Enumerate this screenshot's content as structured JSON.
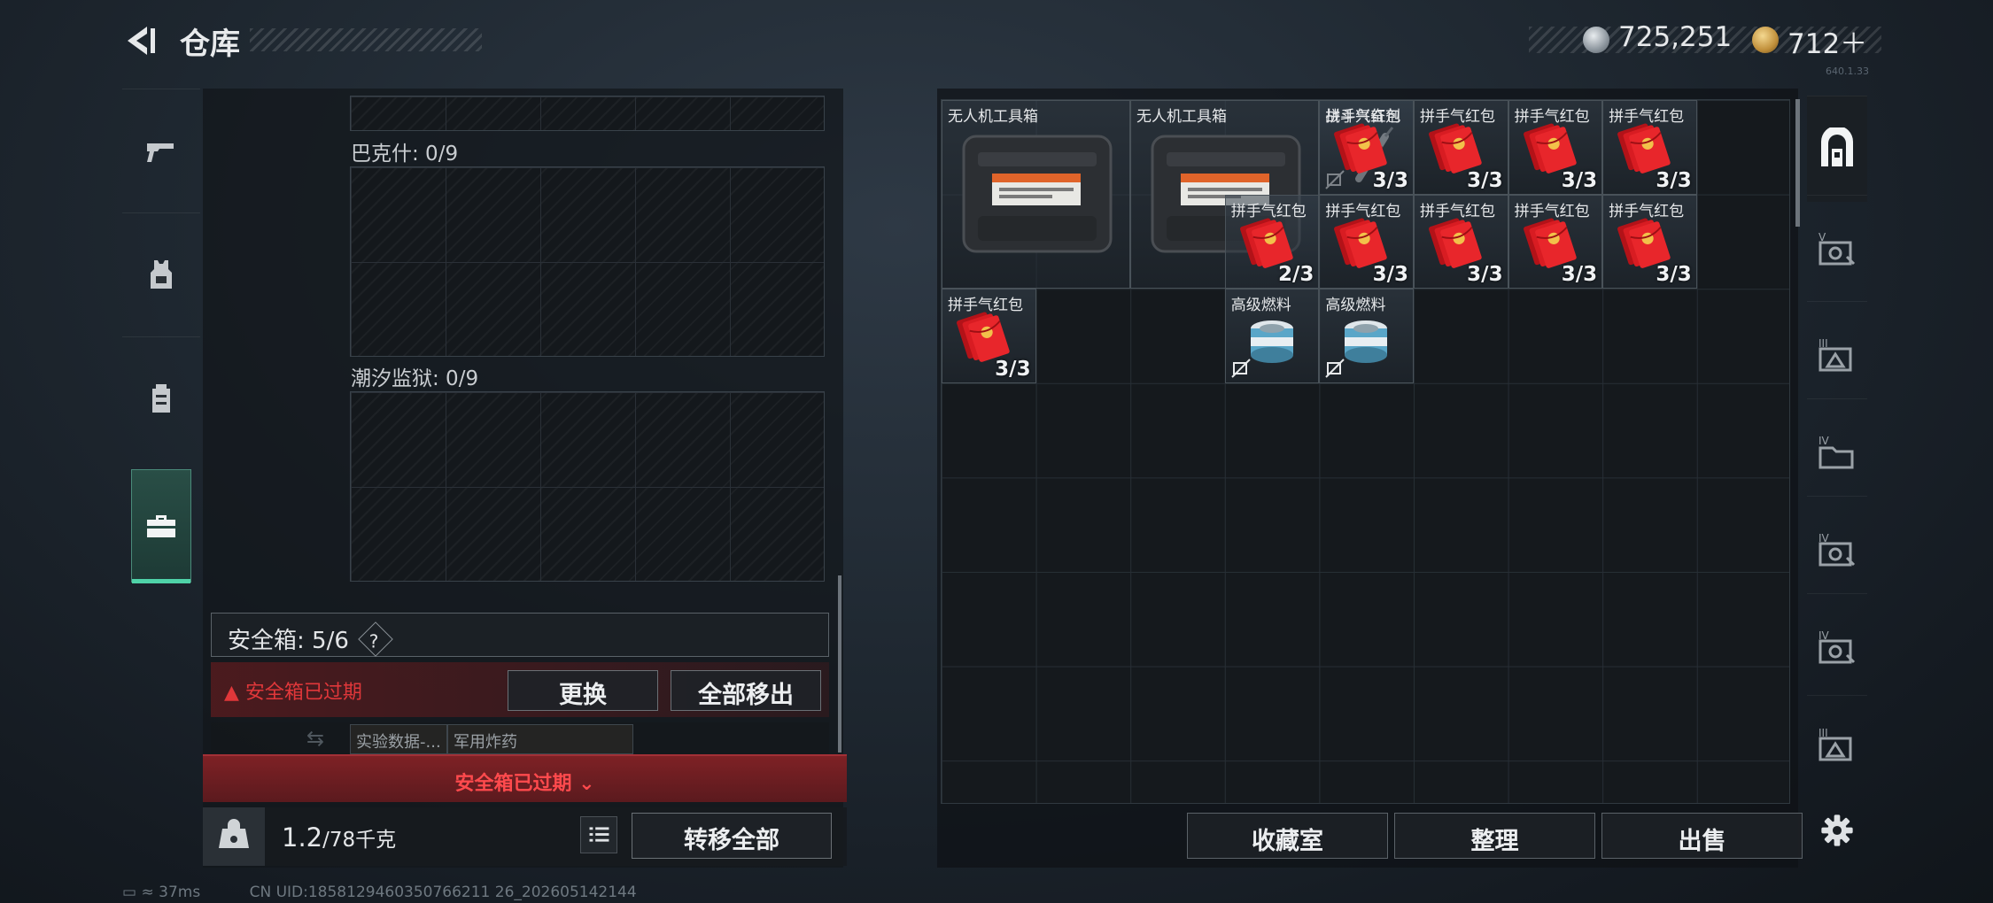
{
  "header": {
    "title": "仓库",
    "currency1": "725,251",
    "currency2": "712＋",
    "version": "640.1.33"
  },
  "left_tabs": [
    {
      "icon": "pistol-icon"
    },
    {
      "icon": "vest-icon"
    },
    {
      "icon": "backpack-icon"
    },
    {
      "icon": "toolbox-icon"
    }
  ],
  "containers": [
    {
      "label": "巴克什: 0/9"
    },
    {
      "label": "潮汐监狱: 0/9"
    }
  ],
  "safe_box": {
    "label": "安全箱: 5/6",
    "help": "?",
    "expired": "安全箱已过期",
    "replace": "更换",
    "move_all_out": "全部移出"
  },
  "trash_chips": [
    "实验数据-...",
    "军用炸药"
  ],
  "expired_banner": "安全箱已过期",
  "capacity": {
    "current": "1.2",
    "max": "/78千克",
    "transfer_all": "转移全部"
  },
  "stash_items": [
    {
      "name": "无人机工具箱",
      "count": ""
    },
    {
      "name": "无人机工具箱",
      "count": ""
    },
    {
      "name": "战斗兴奋剂",
      "count": ""
    },
    {
      "name": "拼手气红包",
      "count": "3/3"
    },
    {
      "name": "拼手气红包",
      "count": "3/3"
    },
    {
      "name": "拼手气红包",
      "count": "3/3"
    },
    {
      "name": "拼手气红包",
      "count": "3/3"
    },
    {
      "name": "拼手气红包",
      "count": "2/3"
    },
    {
      "name": "拼手气红包",
      "count": "3/3"
    },
    {
      "name": "拼手气红包",
      "count": "3/3"
    },
    {
      "name": "拼手气红包",
      "count": "3/3"
    },
    {
      "name": "拼手气红包",
      "count": "3/3"
    },
    {
      "name": "拼手气红包",
      "count": "3/3"
    },
    {
      "name": "高级燃料",
      "count": ""
    },
    {
      "name": "高级燃料",
      "count": ""
    }
  ],
  "bottom_buttons": {
    "collection": "收藏室",
    "organize": "整理",
    "sell": "出售"
  },
  "right_tabs": [
    "stash-main-icon",
    "stash-v-icon",
    "stash-iii-icon",
    "stash-iv-a-icon",
    "stash-iv-b-icon",
    "stash-iv-c-icon",
    "stash-iii-b-icon",
    "settings-icon"
  ],
  "status": {
    "ping": "37ms",
    "uid": "CN UID:1858129460350766211 26_202605142144"
  }
}
